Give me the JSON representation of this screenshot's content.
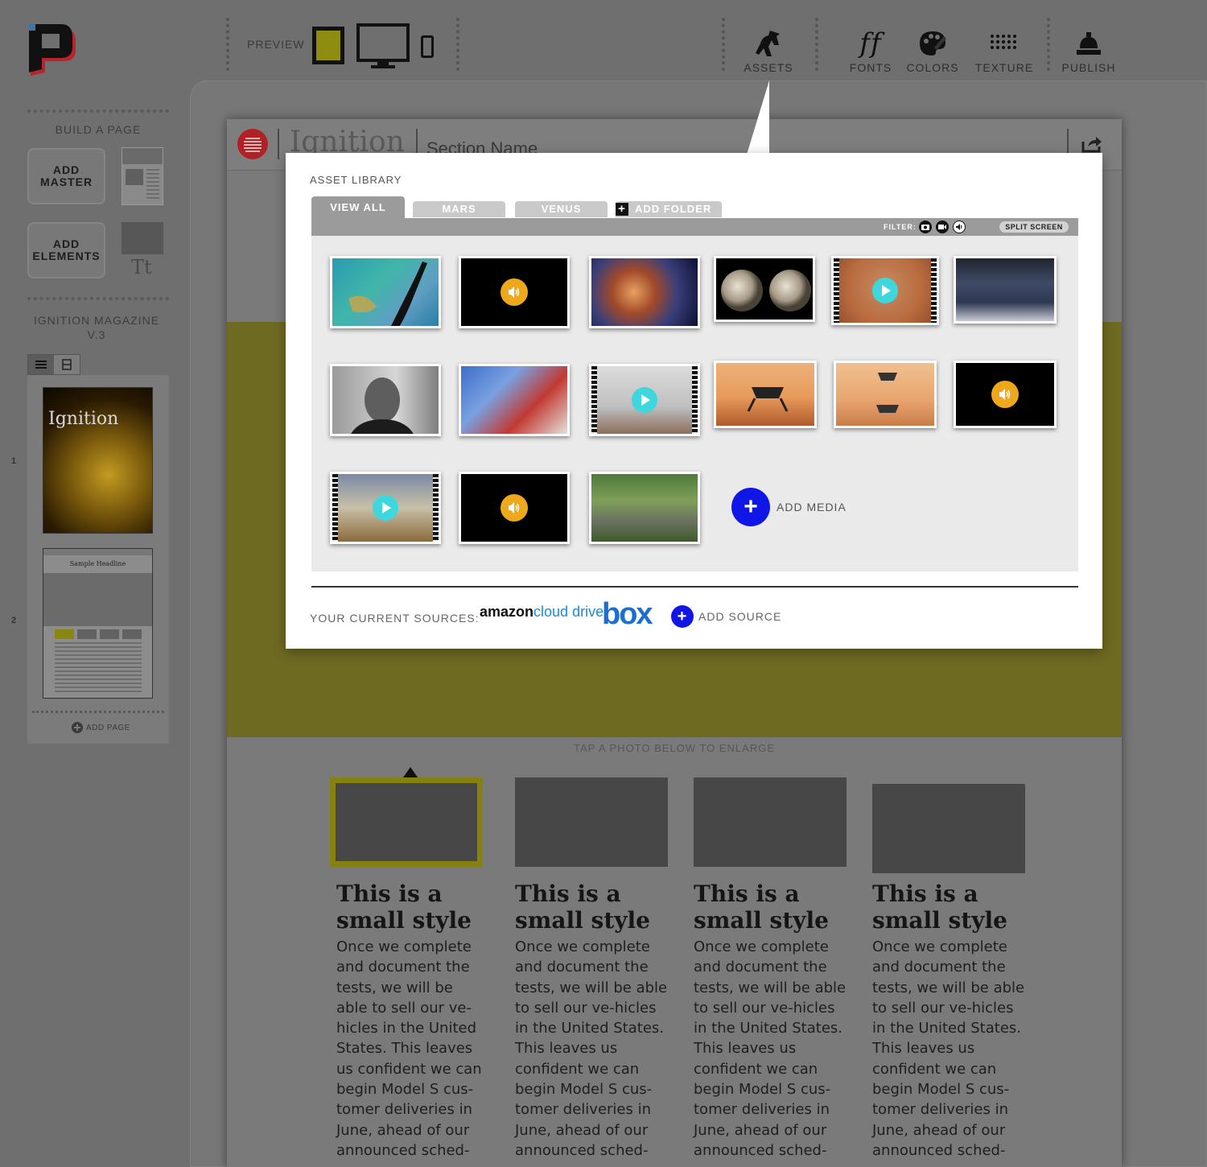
{
  "toolbar": {
    "preview_label": "PREVIEW",
    "assets_label": "ASSETS",
    "fonts_label": "FONTS",
    "fonts_glyph": "ff",
    "colors_label": "COLORS",
    "texture_label": "TEXTURE",
    "publish_label": "PUBLISH",
    "preview_devices": [
      "tablet",
      "desktop",
      "phone"
    ],
    "selected_device": "tablet"
  },
  "sidebar": {
    "build_label": "BUILD A PAGE",
    "add_master_label": "ADD MASTER",
    "add_elements_label": "ADD ELEMENTS",
    "elements_glyph": "Tt",
    "publication_title": "IGNITION MAGAZINE V.3",
    "pages": [
      {
        "number": "1",
        "thumb_title": "Ignition"
      },
      {
        "number": "2",
        "thumb_title": "Sample Headline"
      }
    ],
    "add_page_label": "ADD PAGE"
  },
  "document": {
    "title": "Ignition",
    "section_name": "Section Name",
    "tap_note": "TAP A PHOTO BELOW TO ENLARGE",
    "cards": [
      {
        "headline": "This is a small style",
        "body": "Once we complete and document the tests, we will be able to sell our ve-hicles in the United States. This leaves us confident we can begin Model S cus-tomer deliveries in June, ahead of our announced sched-"
      },
      {
        "headline": "This is a small style",
        "body": "Once we complete and document the tests, we will be able to sell our ve-hicles in the United States. This leaves us confident we can begin Model S cus-tomer deliveries in June, ahead of our announced sched-"
      },
      {
        "headline": "This is a small style",
        "body": "Once we complete and document the tests, we will be able to sell our ve-hicles in the United States. This leaves us confident we can begin Model S cus-tomer deliveries in June, ahead of our announced sched-"
      },
      {
        "headline": "This is a small style",
        "body": "Once we complete and document the tests, we will be able to sell our ve-hicles in the United States. This leaves us confident we can begin Model S cus-tomer deliveries in June, ahead of our announced sched-"
      }
    ]
  },
  "asset_library": {
    "title": "ASSET LIBRARY",
    "tabs": [
      "VIEW ALL",
      "MARS",
      "VENUS"
    ],
    "active_tab": "VIEW ALL",
    "add_folder_label": "ADD FOLDER",
    "filter_label": "FILTER:",
    "filter_icons": [
      "camera-icon",
      "video-icon",
      "audio-icon"
    ],
    "split_screen_label": "SPLIT SCREEN",
    "assets": [
      {
        "kind": "image",
        "name": "satellite-map-image"
      },
      {
        "kind": "audio",
        "name": "audio-clip-1"
      },
      {
        "kind": "image",
        "name": "nebula-image"
      },
      {
        "kind": "image",
        "name": "planets-image"
      },
      {
        "kind": "video",
        "name": "mars-surface-video"
      },
      {
        "kind": "image",
        "name": "mission-control-image"
      },
      {
        "kind": "image",
        "name": "portrait-image"
      },
      {
        "kind": "image",
        "name": "protest-image"
      },
      {
        "kind": "video",
        "name": "lab-video"
      },
      {
        "kind": "image",
        "name": "lander-image"
      },
      {
        "kind": "image",
        "name": "sky-crane-image"
      },
      {
        "kind": "audio",
        "name": "audio-clip-2"
      },
      {
        "kind": "video",
        "name": "box-unpacking-video"
      },
      {
        "kind": "audio",
        "name": "audio-clip-3"
      },
      {
        "kind": "image",
        "name": "hiker-image"
      }
    ],
    "add_media_label": "ADD MEDIA",
    "sources_label": "YOUR CURRENT SOURCES:",
    "sources": [
      {
        "name_bold": "amazon",
        "name_light": "cloud drive"
      },
      {
        "name": "box"
      }
    ],
    "add_source_label": "ADD SOURCE"
  },
  "colors": {
    "accent_olive": "#6e6a22",
    "selected_border": "#868210",
    "add_blue": "#1016e6",
    "play_cyan": "#3ed7de",
    "audio_amber": "#eda81b",
    "menu_red": "#b02024"
  }
}
